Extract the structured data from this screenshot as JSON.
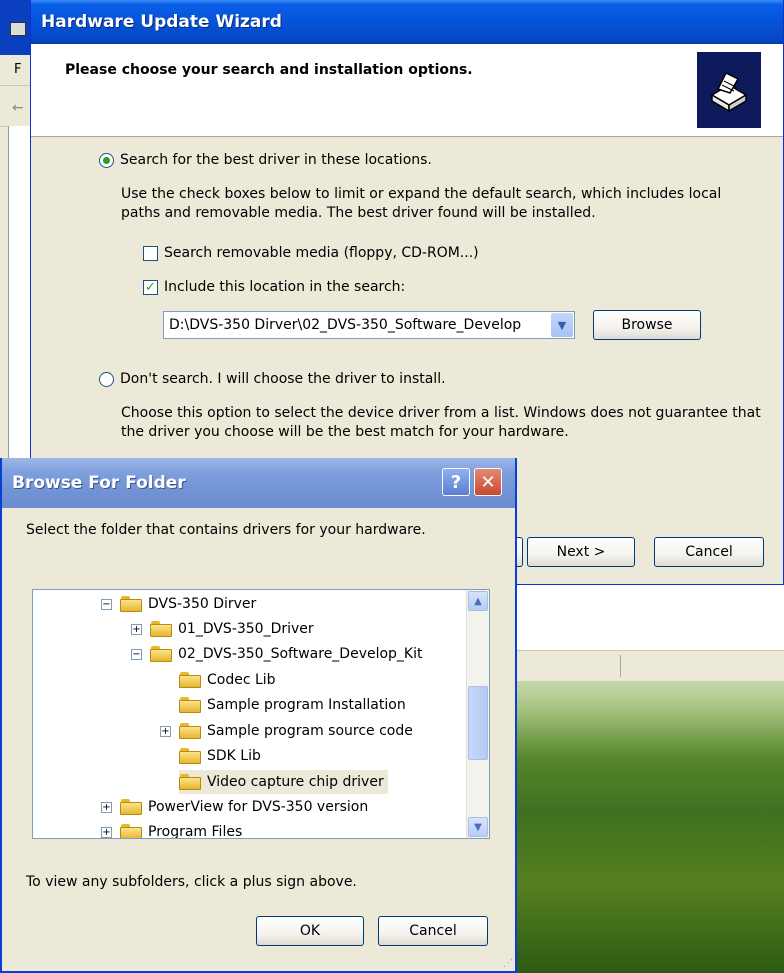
{
  "background_window": {
    "menu_letter": "F",
    "back_arrow": "←"
  },
  "wizard": {
    "title": "Hardware Update Wizard",
    "header_title": "Please choose your search and installation options.",
    "option_search": {
      "label": "Search for the best driver in these locations.",
      "selected": true,
      "description": "Use the check boxes below to limit or expand the default search, which includes local paths and removable media. The best driver found will be installed."
    },
    "checkbox_removable": {
      "label": "Search removable media (floppy, CD-ROM...)",
      "checked": false
    },
    "checkbox_location": {
      "label": "Include this location in the search:",
      "checked": true,
      "mark": "✓"
    },
    "location_path": "D:\\DVS-350 Dirver\\02_DVS-350_Software_Develop",
    "browse_button": "Browse",
    "option_dont_search": {
      "label": "Don't search. I will choose the driver to install.",
      "selected": false,
      "description": "Choose this option to select the device driver from a list.  Windows does not guarantee that the driver you choose will be the best match for your hardware."
    },
    "next_button": "Next >",
    "cancel_button": "Cancel"
  },
  "browse_dialog": {
    "title": "Browse For Folder",
    "help_glyph": "?",
    "close_glyph": "✕",
    "instruction": "Select the folder that contains drivers for your hardware.",
    "tree": [
      {
        "label": "DVS-350 Dirver",
        "level": 0,
        "toggle": "−"
      },
      {
        "label": "01_DVS-350_Driver",
        "level": 1,
        "toggle": "+"
      },
      {
        "label": "02_DVS-350_Software_Develop_Kit",
        "level": 1,
        "toggle": "−"
      },
      {
        "label": "Codec Lib",
        "level": 2,
        "toggle": ""
      },
      {
        "label": "Sample program Installation",
        "level": 2,
        "toggle": ""
      },
      {
        "label": "Sample program source code",
        "level": 2,
        "toggle": "+"
      },
      {
        "label": "SDK Lib",
        "level": 2,
        "toggle": ""
      },
      {
        "label": "Video capture chip driver",
        "level": 2,
        "toggle": "",
        "selected": true
      },
      {
        "label": "PowerView for DVS-350 version",
        "level": 0,
        "toggle": "+"
      },
      {
        "label": "Program Files",
        "level": 0,
        "toggle": "+"
      }
    ],
    "hint": "To view any subfolders, click a plus sign above.",
    "ok_button": "OK",
    "cancel_button": "Cancel"
  },
  "colors": {
    "xp_blue": "#0553d8",
    "inactive_title": "#7e9fdc",
    "dialog_face": "#ece9d8",
    "radio_dot": "#21a121"
  }
}
